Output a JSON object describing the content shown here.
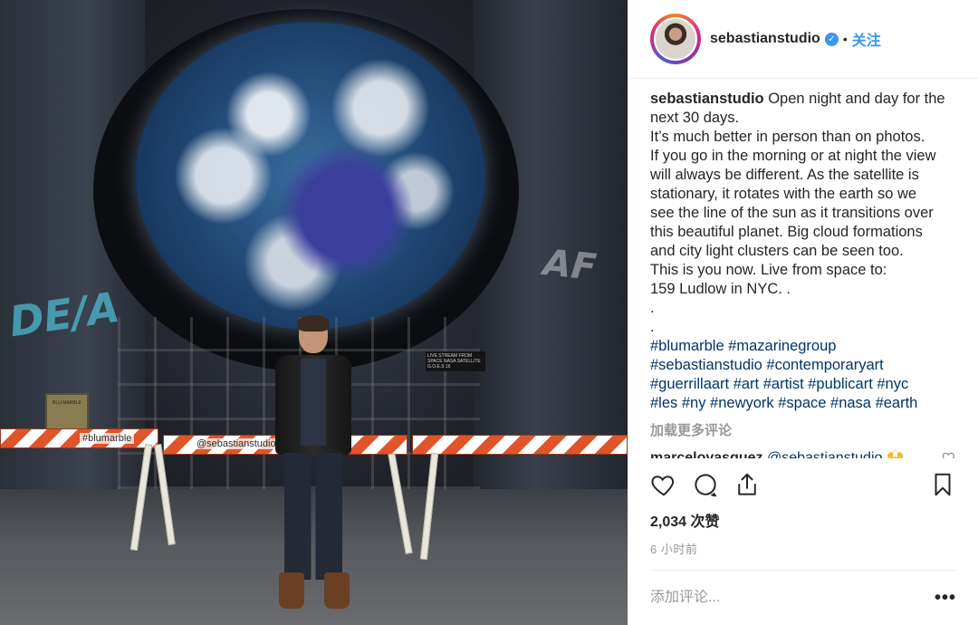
{
  "post": {
    "username": "sebastianstudio",
    "verified_icon": "verified-badge-icon",
    "separator": "•",
    "follow_label": "关注",
    "caption": {
      "username": "sebastianstudio",
      "lines": [
        "Open night and day for the",
        "next 30 days.",
        "It’s much better in person than on photos.",
        "If you go in the morning or at night the view",
        "will always be different. As the satellite is",
        "stationary, it rotates with the earth so we",
        "see the line of the sun as it transitions over",
        "this beautiful planet. Big cloud formations",
        "and city light clusters can be seen too.",
        "This is you now. Live from space to:",
        "159 Ludlow in NYC. .",
        ".",
        "."
      ],
      "hashtags": [
        "#blumarble #mazarinegroup",
        "#sebastianstudio #contemporaryart",
        "#guerrillaart #art #artist #publicart #nyc",
        "#les #ny #newyork #space #nasa #earth"
      ]
    },
    "load_more_label": "加载更多评论",
    "comment": {
      "username": "marcelovasquez",
      "text": "@sebastianstudio 🙌"
    },
    "likes": "2,034 次赞",
    "time_ago": "6 小时前",
    "add_comment_placeholder": "添加评论...",
    "more_options": "•••"
  },
  "photo": {
    "barrier_text_left": "#blumarble",
    "barrier_text_center": "@sebastianstudio",
    "sign_text": "LIVE STREAM FROM SPACE NASA SATELLITE G.O.E.S 16",
    "plaque_text": "BLU MARBLE"
  },
  "colors": {
    "link_blue": "#3897f0",
    "hashtag_blue": "#003569",
    "muted_gray": "#999999",
    "text": "#262626"
  }
}
